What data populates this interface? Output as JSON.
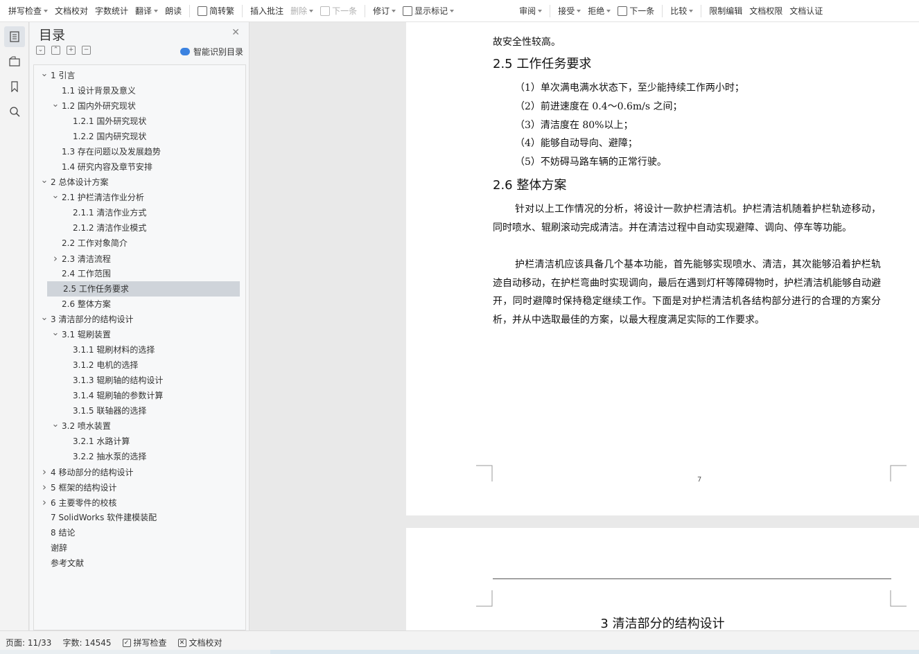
{
  "toolbar": {
    "spell_check": "拼写检查",
    "doc_proof": "文档校对",
    "word_count": "字数统计",
    "translate": "翻译",
    "read_aloud": "朗读",
    "simp_trad": "简转繁",
    "insert_comment": "插入批注",
    "delete": "删除",
    "next_item": "下一条",
    "revise": "修订",
    "show_marks": "显示标记",
    "review": "审阅",
    "accept": "接受",
    "reject": "拒绝",
    "next_item2": "下一条",
    "compare": "比较",
    "restrict_edit": "限制编辑",
    "doc_permission": "文档权限",
    "doc_auth": "文档认证"
  },
  "nav": {
    "title": "目录",
    "smart_toc": "智能识别目录",
    "items": [
      {
        "label": "1 引言",
        "level": 1,
        "toggle": "open"
      },
      {
        "label": "1.1 设计背景及意义",
        "level": 2,
        "toggle": "none"
      },
      {
        "label": "1.2 国内外研究现状",
        "level": 2,
        "toggle": "open"
      },
      {
        "label": "1.2.1 国外研究现状",
        "level": 3,
        "toggle": "none"
      },
      {
        "label": "1.2.2 国内研究现状",
        "level": 3,
        "toggle": "none"
      },
      {
        "label": "1.3 存在问题以及发展趋势",
        "level": 2,
        "toggle": "none"
      },
      {
        "label": "1.4 研究内容及章节安排",
        "level": 2,
        "toggle": "none"
      },
      {
        "label": "2 总体设计方案",
        "level": 1,
        "toggle": "open"
      },
      {
        "label": "2.1 护栏清洁作业分析",
        "level": 2,
        "toggle": "open"
      },
      {
        "label": "2.1.1 清洁作业方式",
        "level": 3,
        "toggle": "none"
      },
      {
        "label": "2.1.2 清洁作业模式",
        "level": 3,
        "toggle": "none"
      },
      {
        "label": "2.2 工作对象简介",
        "level": 2,
        "toggle": "none"
      },
      {
        "label": "2.3 清洁流程",
        "level": 2,
        "toggle": "closed"
      },
      {
        "label": "2.4 工作范围",
        "level": 2,
        "toggle": "none"
      },
      {
        "label": "2.5 工作任务要求",
        "level": 2,
        "toggle": "none",
        "selected": true
      },
      {
        "label": "2.6 整体方案",
        "level": 2,
        "toggle": "none"
      },
      {
        "label": "3 清洁部分的结构设计",
        "level": 1,
        "toggle": "open"
      },
      {
        "label": "3.1 辊刷装置",
        "level": 2,
        "toggle": "open"
      },
      {
        "label": "3.1.1 辊刷材料的选择",
        "level": 3,
        "toggle": "none"
      },
      {
        "label": "3.1.2 电机的选择",
        "level": 3,
        "toggle": "none"
      },
      {
        "label": "3.1.3 辊刷轴的结构设计",
        "level": 3,
        "toggle": "none"
      },
      {
        "label": "3.1.4 辊刷轴的参数计算",
        "level": 3,
        "toggle": "none"
      },
      {
        "label": "3.1.5 联轴器的选择",
        "level": 3,
        "toggle": "none"
      },
      {
        "label": "3.2 喷水装置",
        "level": 2,
        "toggle": "open"
      },
      {
        "label": "3.2.1 水路计算",
        "level": 3,
        "toggle": "none"
      },
      {
        "label": "3.2.2 抽水泵的选择",
        "level": 3,
        "toggle": "none"
      },
      {
        "label": "4 移动部分的结构设计",
        "level": 1,
        "toggle": "closed"
      },
      {
        "label": "5 框架的结构设计",
        "level": 1,
        "toggle": "closed"
      },
      {
        "label": "6 主要零件的校核",
        "level": 1,
        "toggle": "closed"
      },
      {
        "label": "7 SolidWorks 软件建模装配",
        "level": 1,
        "toggle": "none"
      },
      {
        "label": "8 结论",
        "level": 1,
        "toggle": "none"
      },
      {
        "label": "谢辞",
        "level": 1,
        "toggle": "none"
      },
      {
        "label": "参考文献",
        "level": 1,
        "toggle": "none"
      }
    ]
  },
  "doc": {
    "top_cut": "故安全性较高。",
    "h_25": "2.5 工作任务要求",
    "req_lines": [
      "（1）单次满电满水状态下，至少能持续工作两小时；",
      "（2）前进速度在 0.4～0.6m/s 之间；",
      "（3）清洁度在 80%以上；",
      "（4）能够自动导向、避障；",
      "（5）不妨碍马路车辆的正常行驶。"
    ],
    "h_26": "2.6 整体方案",
    "para1": "针对以上工作情况的分析，将设计一款护栏清洁机。护栏清洁机随着护栏轨迹移动，同时喷水、辊刷滚动完成清洁。并在清洁过程中自动实现避障、调向、停车等功能。",
    "para2": "护栏清洁机应该具备几个基本功能，首先能够实现喷水、清洁，其次能够沿着护栏轨迹自动移动，在护栏弯曲时实现调向，最后在遇到灯杆等障碍物时，护栏清洁机能够自动避开，同时避障时保持稳定继续工作。下面是对护栏清洁机各结构部分进行的合理的方案分析，并从中选取最佳的方案，以最大程度满足实际的工作要求。",
    "page_number": "7",
    "next_h1": "3 清洁部分的结构设计"
  },
  "status": {
    "page": "页面: 11/33",
    "words": "字数: 14545",
    "spell_check": "拼写检查",
    "doc_proof": "文档校对"
  }
}
